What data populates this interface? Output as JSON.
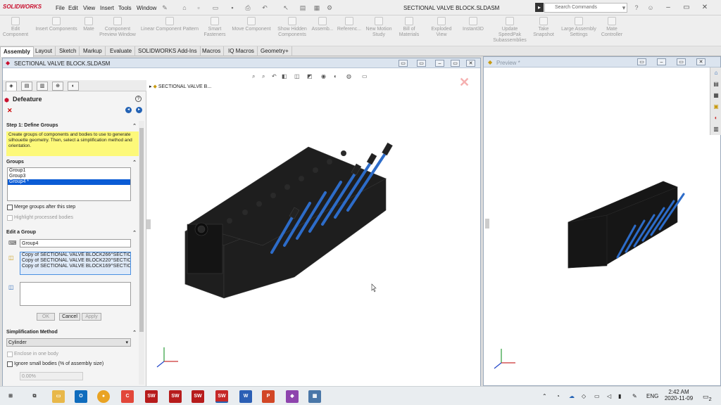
{
  "app": {
    "logo": "SOLIDWORKS",
    "doc_title": "SECTIONAL VALVE BLOCK.SLDASM",
    "search_placeholder": "Search Commands"
  },
  "menu": [
    "File",
    "Edit",
    "View",
    "Insert",
    "Tools",
    "Window"
  ],
  "commands": [
    {
      "label": "Edit\nComponent"
    },
    {
      "label": "Insert Components"
    },
    {
      "label": "Mate"
    },
    {
      "label": "Component\nPreview Window"
    },
    {
      "label": "Linear Component Pattern"
    },
    {
      "label": "Smart\nFasteners"
    },
    {
      "label": "Move Component"
    },
    {
      "label": "Show Hidden\nComponents"
    },
    {
      "label": "Assemb..."
    },
    {
      "label": "Referenc..."
    },
    {
      "label": "New Motion\nStudy"
    },
    {
      "label": "Bill of\nMaterials"
    },
    {
      "label": "Exploded View"
    },
    {
      "label": "Instant3D"
    },
    {
      "label": "Update SpeedPak\nSubassemblies"
    },
    {
      "label": "Take\nSnapshot"
    },
    {
      "label": "Large Assembly\nSettings"
    },
    {
      "label": "Mate\nController"
    }
  ],
  "tabs": [
    "Assembly",
    "Layout",
    "Sketch",
    "Markup",
    "Evaluate",
    "SOLIDWORKS Add-Ins",
    "Macros",
    "IQ Macros",
    "Geometry+"
  ],
  "active_tab": "Assembly",
  "docwin_title": "SECTIONAL VALVE BLOCK.SLDASM",
  "feature_tree_item": "SECTIONAL VALVE B...",
  "pm": {
    "title": "Defeature",
    "step_title": "Step 1: Define Groups",
    "info": "Create groups of components and bodies to use to generate silhouette geometry. Then, select a simplification method and orientation.",
    "groups_title": "Groups",
    "groups": [
      "Group1",
      "Group3",
      "Group4 *"
    ],
    "merge_label": "Merge groups after this step",
    "highlight_label": "Highlight processed bodies",
    "edit_title": "Edit a Group",
    "group_name": "Group4",
    "components": [
      "Copy of SECTIONAL VALVE BLOCK266^SECTIC",
      "Copy of SECTIONAL VALVE BLOCK220^SECTIC",
      "Copy of SECTIONAL VALVE BLOCK169^SECTIC"
    ],
    "ok": "OK",
    "cancel": "Cancel",
    "apply": "Apply",
    "simp_title": "Simplification Method",
    "simp_value": "Cylinder",
    "enclose_label": "Enclose in one body",
    "ignore_label": "Ignore small bodies (% of assembly size)",
    "pct": "0.00%"
  },
  "preview_title": "Preview *",
  "clock": {
    "time": "2:42 AM",
    "date": "2020-11-09"
  },
  "lang": "ENG",
  "notif_count": "2"
}
